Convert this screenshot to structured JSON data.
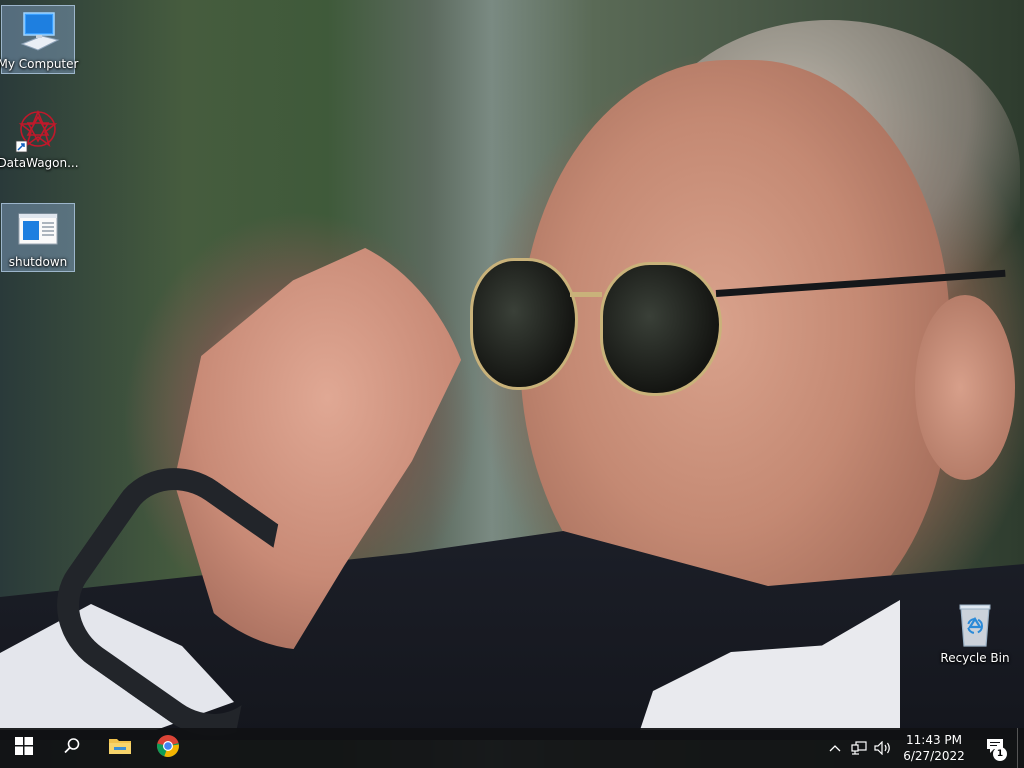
{
  "desktop": {
    "icons": [
      {
        "label": "My Computer",
        "icon": "monitor-icon",
        "selected": true
      },
      {
        "label": "DataWagon...",
        "icon": "datawagon-star-icon",
        "selected": false
      },
      {
        "label": "shutdown",
        "icon": "shutdown-script-icon",
        "selected": true
      },
      {
        "label": "Recycle Bin",
        "icon": "recycle-bin-icon",
        "selected": false
      }
    ]
  },
  "taskbar": {
    "start_icon": "windows-logo-icon",
    "search_icon": "search-icon",
    "pinned": [
      {
        "name": "File Explorer",
        "icon": "folder-icon"
      },
      {
        "name": "Google Chrome",
        "icon": "chrome-icon"
      }
    ],
    "tray": {
      "chevron_icon": "chevron-up-icon",
      "network_icon": "network-icon",
      "volume_icon": "volume-icon",
      "time": "11:43 PM",
      "date": "6/27/2022",
      "notification_count": "1"
    }
  },
  "colors": {
    "taskbar_bg": "#101113",
    "selection_bg": "#7896b4",
    "accent_blue": "#1e90ff"
  }
}
